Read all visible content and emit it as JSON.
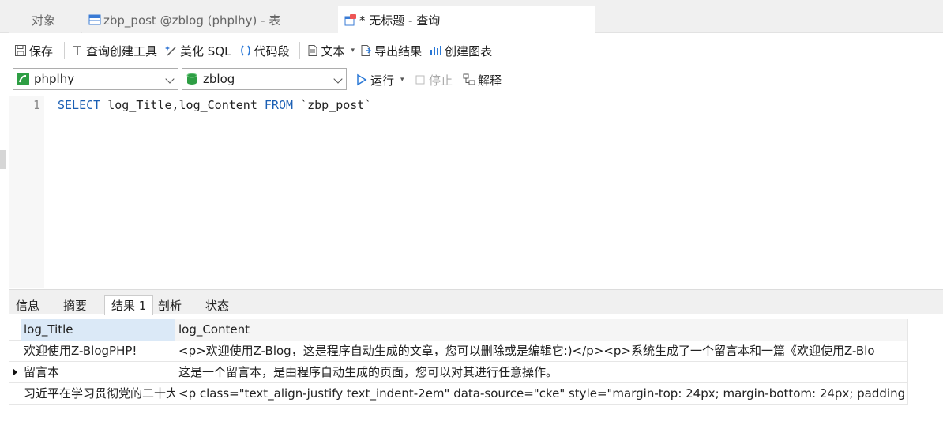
{
  "tabs": [
    {
      "label": "对象"
    },
    {
      "label": "zbp_post @zblog (phplhy) - 表"
    },
    {
      "label": "* 无标题 - 查询"
    }
  ],
  "toolbar": {
    "save": "保存",
    "query_builder": "查询创建工具",
    "beautify": "美化 SQL",
    "code_snippet": "代码段",
    "text": "文本",
    "export": "导出结果",
    "create_chart": "创建图表"
  },
  "connection": {
    "selected": "phplhy"
  },
  "database": {
    "selected": "zblog"
  },
  "actions": {
    "run": "运行",
    "stop": "停止",
    "explain": "解释"
  },
  "editor": {
    "line_number": "1",
    "kw_select": "SELECT",
    "fields": "log_Title,log_Content",
    "kw_from": "FROM",
    "table": "`zbp_post`"
  },
  "result_tabs": [
    {
      "label": "信息"
    },
    {
      "label": "摘要"
    },
    {
      "label": "结果 1"
    },
    {
      "label": "剖析"
    },
    {
      "label": "状态"
    }
  ],
  "grid": {
    "columns": [
      "log_Title",
      "log_Content"
    ],
    "rows": [
      {
        "title": "欢迎使用Z-BlogPHP!",
        "content": "<p>欢迎使用Z-Blog，这是程序自动生成的文章，您可以删除或是编辑它:)</p><p>系统生成了一个留言本和一篇《欢迎使用Z-Blo"
      },
      {
        "title": "留言本",
        "content": "这是一个留言本，是由程序自动生成的页面，您可以对其进行任意操作。"
      },
      {
        "title": "习近平在学习贯彻党的二十大",
        "content": "<p class=\"text_align-justify text_indent-2em\" data-source=\"cke\" style=\"margin-top: 24px; margin-bottom: 24px; padding"
      }
    ]
  },
  "colors": {
    "keyword": "#1a5fb4",
    "selection_header": "#dbe9f7",
    "connection_icon": "#2e9e44",
    "database_icon": "#2e9e44",
    "run_icon": "#2a78d6"
  }
}
